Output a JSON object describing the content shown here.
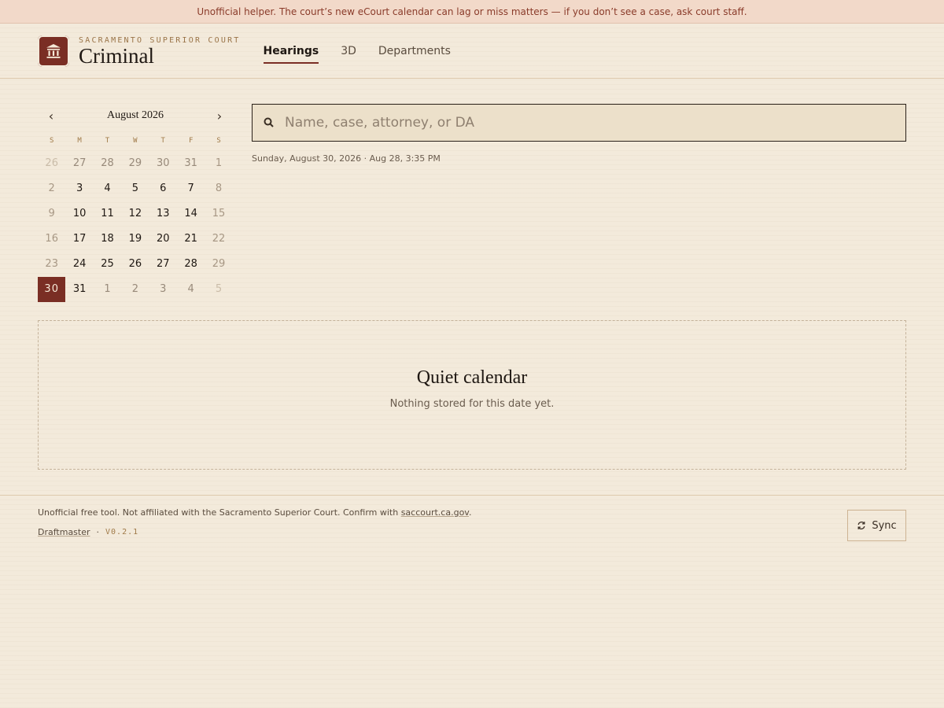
{
  "banner": {
    "text": "Unofficial helper. The court’s new eCourt calendar can lag or miss matters — if you don’t see a case, ask court staff."
  },
  "brand": {
    "subtitle": "SACRAMENTO SUPERIOR COURT",
    "title": "Criminal"
  },
  "nav": [
    {
      "label": "Hearings",
      "active": true
    },
    {
      "label": "3D",
      "active": false
    },
    {
      "label": "Departments",
      "active": false
    }
  ],
  "calendar": {
    "prev": "‹",
    "next": "›",
    "month_label": "August 2026",
    "weekdays": [
      "S",
      "M",
      "T",
      "W",
      "T",
      "F",
      "S"
    ],
    "weeks": [
      [
        "26",
        "27",
        "28",
        "29",
        "30",
        "31",
        "1"
      ],
      [
        "2",
        "3",
        "4",
        "5",
        "6",
        "7",
        "8"
      ],
      [
        "9",
        "10",
        "11",
        "12",
        "13",
        "14",
        "15"
      ],
      [
        "16",
        "17",
        "18",
        "19",
        "20",
        "21",
        "22"
      ],
      [
        "23",
        "24",
        "25",
        "26",
        "27",
        "28",
        "29"
      ],
      [
        "30",
        "31",
        "1",
        "2",
        "3",
        "4",
        "5"
      ]
    ],
    "selected": "30"
  },
  "search": {
    "placeholder": "Name, case, attorney, or DA",
    "value": ""
  },
  "date_line": "Sunday, August 30, 2026 · Aug 28, 3:35 PM",
  "empty": {
    "title": "Quiet calendar",
    "subtitle": "Nothing stored for this date yet."
  },
  "footer": {
    "text_before": "Unofficial free tool. Not affiliated with the Sacramento Superior Court. Confirm with ",
    "link": "saccourt.ca.gov",
    "text_after": ".",
    "credit": "Draftmaster",
    "separator": "·",
    "version": "V0.2.1",
    "sync_label": "Sync"
  },
  "colors": {
    "accent": "#7a2e24",
    "background": "#f3eadb",
    "banner_bg": "#f2d9c9",
    "banner_text": "#8a3b2a"
  },
  "icons": {
    "logo": "courthouse-icon",
    "search": "search-icon",
    "sync": "refresh-icon"
  }
}
